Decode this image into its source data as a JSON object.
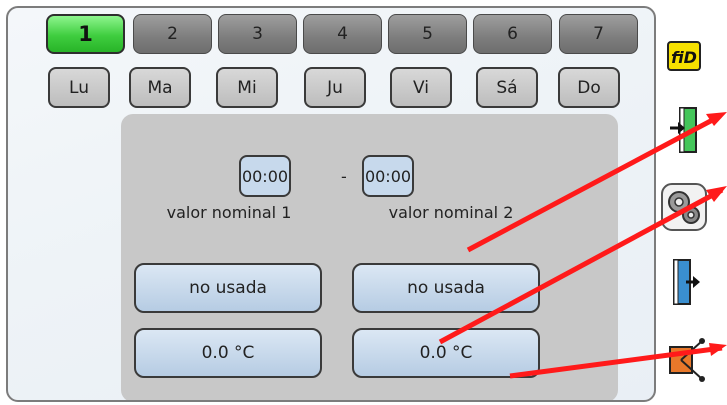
{
  "programs": [
    "1",
    "2",
    "3",
    "4",
    "5",
    "6",
    "7"
  ],
  "active_program": "1",
  "days": [
    "Lu",
    "Ma",
    "Mi",
    "Ju",
    "Vi",
    "Sá",
    "Do"
  ],
  "time_range": {
    "start": "00:00",
    "separator": "-",
    "end": "00:00"
  },
  "setpoints": [
    {
      "label": "valor nominal 1",
      "mode": "no usada",
      "value": "0.0 °C"
    },
    {
      "label": "valor nominal 2",
      "mode": "no usada",
      "value": "0.0 °C"
    }
  ],
  "sidebar": {
    "fid_label": "fiD",
    "icons": [
      "fid-icon",
      "login-icon",
      "settings-gear-icon",
      "logout-icon",
      "network-node-icon"
    ]
  },
  "colors": {
    "active_program": "#3fcd3f",
    "annotation": "#ff1a1a",
    "field": "#c7d9ec"
  }
}
